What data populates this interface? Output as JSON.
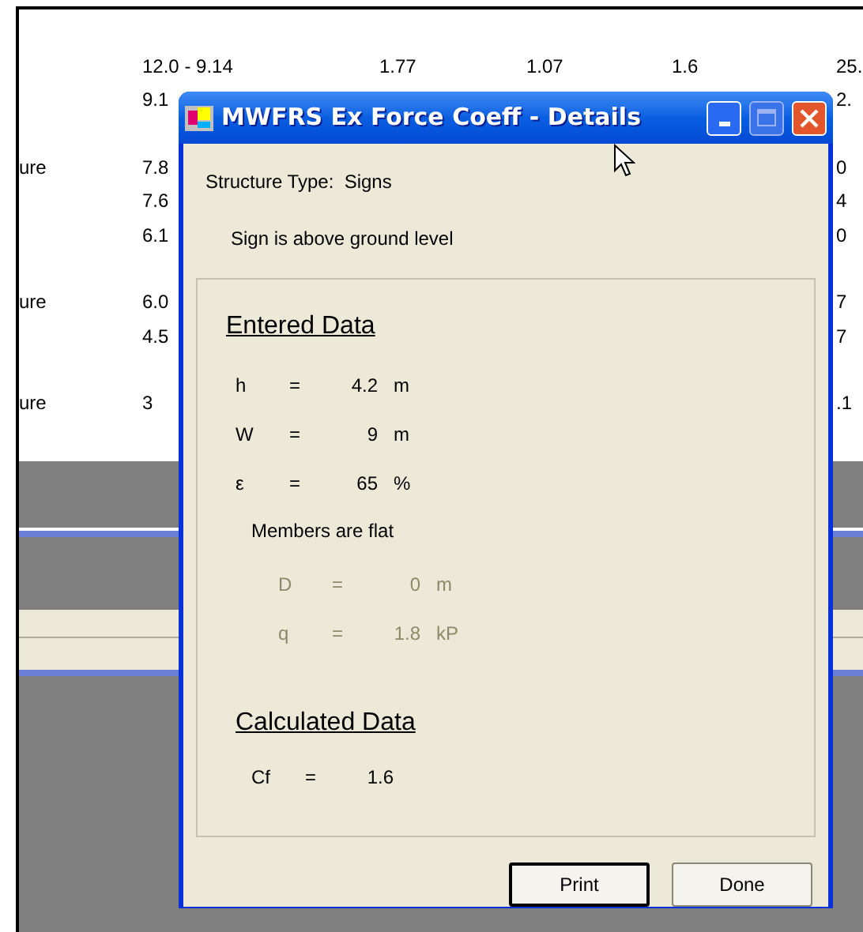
{
  "background": {
    "groups": [
      {
        "rows": [
          {
            "column_2": "12.0 - 9.14",
            "column_3": "1.77",
            "column_4": "1.07",
            "column_5": "1.6",
            "column_6": "25."
          },
          {
            "column_2": "9.1",
            "column_6": "2."
          }
        ]
      },
      {
        "rows": [
          {
            "column_1": "ure",
            "column_2": "7.8",
            "column_6": "0"
          },
          {
            "column_2": "7.6",
            "column_6": "4"
          },
          {
            "column_2": "6.1",
            "column_6": "0"
          }
        ]
      },
      {
        "rows": [
          {
            "column_1": "ure",
            "column_2": "6.0",
            "column_6": "7"
          },
          {
            "column_2": "4.5",
            "column_6": "7"
          }
        ]
      },
      {
        "rows": [
          {
            "column_1": "ure",
            "column_2": "3",
            "column_6": ".1"
          }
        ]
      }
    ]
  },
  "dialog": {
    "title": "MWFRS Ex Force Coeff - Details",
    "structure_type": "Structure Type:  Signs",
    "note": "Sign is above ground level",
    "entered_data": {
      "heading": "Entered Data",
      "fields": [
        {
          "symbol": "h",
          "equals": "=",
          "value": "4.2",
          "unit": "m",
          "disabled": false
        },
        {
          "symbol": "W",
          "equals": "=",
          "value": "9",
          "unit": "m",
          "disabled": false
        },
        {
          "symbol": "ε",
          "equals": "=",
          "value": "65",
          "unit": "%",
          "disabled": false
        }
      ],
      "members_note": "Members are flat",
      "member_fields": [
        {
          "symbol": "D",
          "equals": "=",
          "value": "0",
          "unit": "m",
          "disabled": true
        },
        {
          "symbol": "q",
          "equals": "=",
          "value": "1.8",
          "unit": "kP",
          "disabled": true
        }
      ]
    },
    "calculated_data": {
      "heading": "Calculated Data",
      "fields": [
        {
          "symbol": "Cf",
          "equals": "=",
          "value": "1.6",
          "disabled": false
        }
      ]
    },
    "buttons": [
      {
        "label": "Print",
        "focused": true
      },
      {
        "label": "Done",
        "focused": false
      }
    ]
  }
}
